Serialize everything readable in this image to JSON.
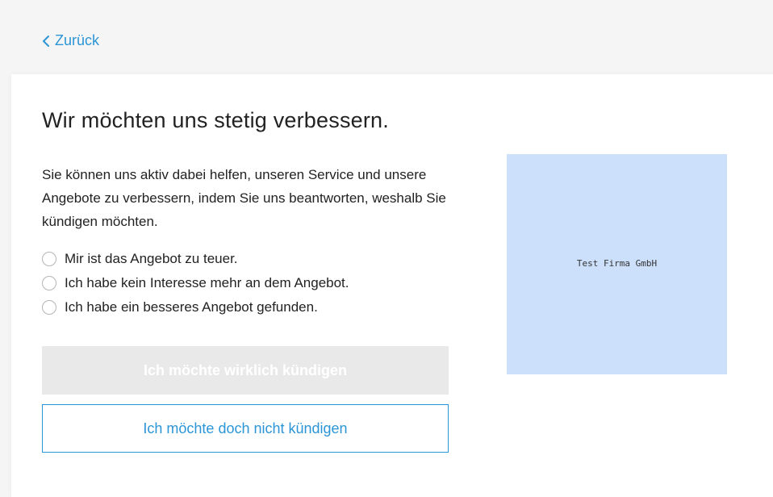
{
  "header": {
    "back_label": "Zurück"
  },
  "main": {
    "title": "Wir möchten uns stetig verbessern.",
    "description": "Sie können uns aktiv dabei helfen, unseren Service und unsere Angebote zu verbessern, indem Sie uns beantworten, weshalb Sie kündigen möchten.",
    "options": [
      {
        "label": "Mir ist das Angebot zu teuer."
      },
      {
        "label": "Ich habe kein Interesse mehr an dem Angebot."
      },
      {
        "label": "Ich habe ein besseres Angebot gefunden."
      }
    ],
    "confirm_cancel_label": "Ich möchte wirklich kündigen",
    "keep_label": "Ich möchte doch nicht kündigen"
  },
  "sidebar": {
    "company_name": "Test Firma GmbH"
  },
  "colors": {
    "accent": "#2b95d6",
    "disabled_button": "#e9e9e9",
    "logo_background": "#cce0fb"
  }
}
